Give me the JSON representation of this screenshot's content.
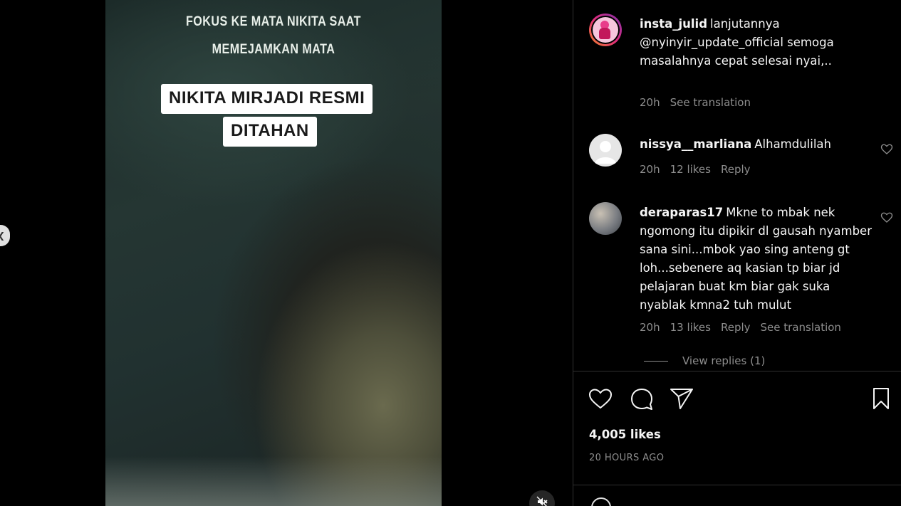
{
  "video": {
    "caption_line1": "FOKUS KE MATA NIKITA SAAT",
    "caption_line2": "MEMEJAMKAN MATA",
    "headline_line1": "NIKITA MIRJADI RESMI",
    "headline_line2": "DITAHAN"
  },
  "comments": [
    {
      "username": "insta_julid",
      "text": "lanjutannya @nyinyir_update_official semoga masalahnya cepat selesai nyai,..",
      "time": "20h",
      "likes": "",
      "reply": "",
      "translate": "See translation",
      "avatar_color": "#e83d8a"
    },
    {
      "username": "nissya__marliana",
      "text": "Alhamdulilah",
      "time": "20h",
      "likes": "12 likes",
      "reply": "Reply",
      "translate": "",
      "avatar_color": "#e8e8e8"
    },
    {
      "username": "deraparas17",
      "text": "Mkne to mbak nek ngomong itu dipikir dl gausah nyamber sana sini...mbok yao sing anteng gt loh...sebenere aq kasian tp biar jd pelajaran buat km biar gak suka nyablak kmna2 tuh mulut",
      "time": "20h",
      "likes": "13 likes",
      "reply": "Reply",
      "translate": "See translation",
      "avatar_color": "#8a8f96"
    }
  ],
  "view_replies": "View replies (1)",
  "likes_count": "4,005 likes",
  "post_time": "20 HOURS AGO",
  "icons": {
    "like": "heart-icon",
    "comment": "comment-bubble-icon",
    "share": "paper-plane-icon",
    "save": "bookmark-icon",
    "mute": "speaker-muted-icon",
    "prev": "chevron-left-icon"
  },
  "colors": {
    "muted_text": "#8e8e8e",
    "divider": "#2f2f2f",
    "story_ring": "#e1306c"
  }
}
